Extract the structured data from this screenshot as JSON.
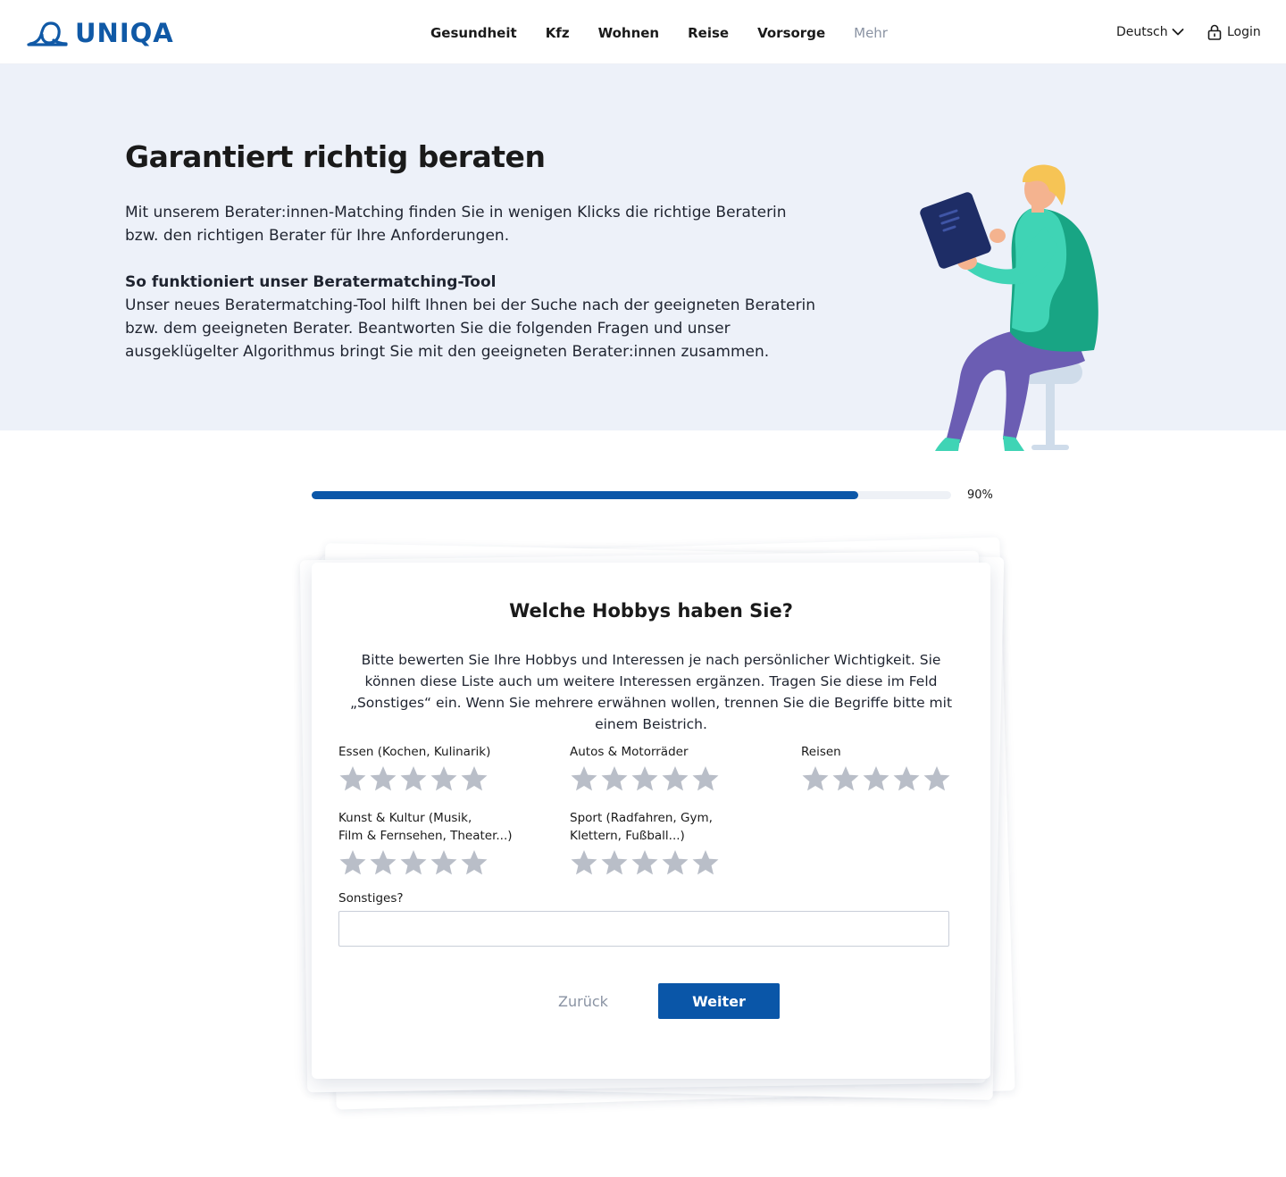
{
  "header": {
    "logo_text": "UNIQA",
    "nav": [
      {
        "label": "Gesundheit"
      },
      {
        "label": "Kfz"
      },
      {
        "label": "Wohnen"
      },
      {
        "label": "Reise"
      },
      {
        "label": "Vorsorge"
      },
      {
        "label": "Mehr"
      }
    ],
    "language": "Deutsch",
    "login": "Login"
  },
  "hero": {
    "title": "Garantiert richtig beraten",
    "intro": "Mit unserem Berater:innen-Matching finden Sie in wenigen Klicks die richtige Beraterin bzw. den richtigen Berater für Ihre Anforderungen.",
    "subheading": "So funktioniert unser Beratermatching-Tool",
    "body": "Unser neues Beratermatching-Tool hilft Ihnen bei der Suche nach der geeigneten Beraterin bzw. dem geeigneten Berater. Beantworten Sie die folgenden Fragen und unser ausgeklügelter Algorithmus bringt Sie mit den geeigneten Berater:innen zusammen."
  },
  "progress": {
    "percent": 90,
    "label": "90%"
  },
  "question": {
    "title": "Welche Hobbys haben Sie?",
    "description": "Bitte bewerten Sie Ihre Hobbys und Interessen je nach persönlicher Wichtigkeit. Sie können diese Liste auch um weitere Interessen ergänzen. Tragen Sie diese im Feld „Sonstiges“ ein. Wenn Sie mehrere erwähnen wollen, trennen Sie die Begriffe bitte mit einem Beistrich.",
    "ratings": [
      {
        "label": "Essen (Kochen, Kulinarik)",
        "value": 0,
        "max": 5
      },
      {
        "label": "Autos & Motorräder",
        "value": 0,
        "max": 5
      },
      {
        "label": "Reisen",
        "value": 0,
        "max": 5
      },
      {
        "label": "Kunst & Kultur (Musik,\nFilm & Fernsehen, Theater...)",
        "value": 0,
        "max": 5
      },
      {
        "label": "Sport (Radfahren, Gym,\nKlettern, Fußball...)",
        "value": 0,
        "max": 5
      }
    ],
    "other_label": "Sonstiges?",
    "other_value": "",
    "back_label": "Zurück",
    "next_label": "Weiter"
  },
  "colors": {
    "brand": "#1059a6",
    "primary_button": "#0a56a8",
    "hero_bg": "#edf1f9",
    "star_empty": "#b9bec8"
  }
}
